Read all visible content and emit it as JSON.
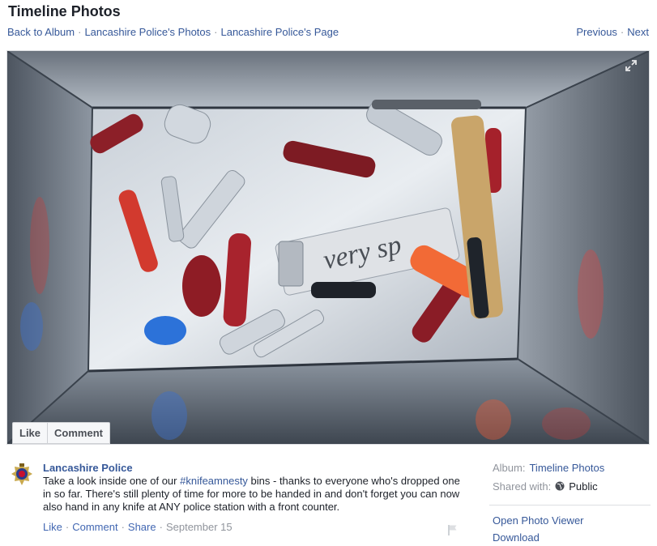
{
  "header": {
    "title": "Timeline Photos",
    "breadcrumb": [
      "Back to Album",
      "Lancashire Police's Photos",
      "Lancashire Police's Page"
    ],
    "pager": {
      "previous": "Previous",
      "next": "Next"
    }
  },
  "photo": {
    "actions": {
      "like": "Like",
      "comment": "Comment"
    },
    "icons": {
      "expand": "expand-icon"
    },
    "newspaper_text": "very sp"
  },
  "post": {
    "author": "Lancashire Police",
    "text_before": "Take a look inside one of our ",
    "hashtag": "#knifeamnesty",
    "text_after": " bins - thanks to everyone who's dropped one in so far. There's still plenty of time for more to be handed in and don't forget you can now also hand in any knife at ANY police station with a front counter.",
    "footer": {
      "like": "Like",
      "comment": "Comment",
      "share": "Share",
      "date": "September 15"
    }
  },
  "sidebar": {
    "album_label": "Album:",
    "album_value": "Timeline Photos",
    "shared_label": "Shared with:",
    "shared_value": "Public",
    "links": [
      "Open Photo Viewer",
      "Download"
    ]
  },
  "colors": {
    "link": "#365899",
    "muted": "#90949c",
    "text": "#1d2129"
  }
}
